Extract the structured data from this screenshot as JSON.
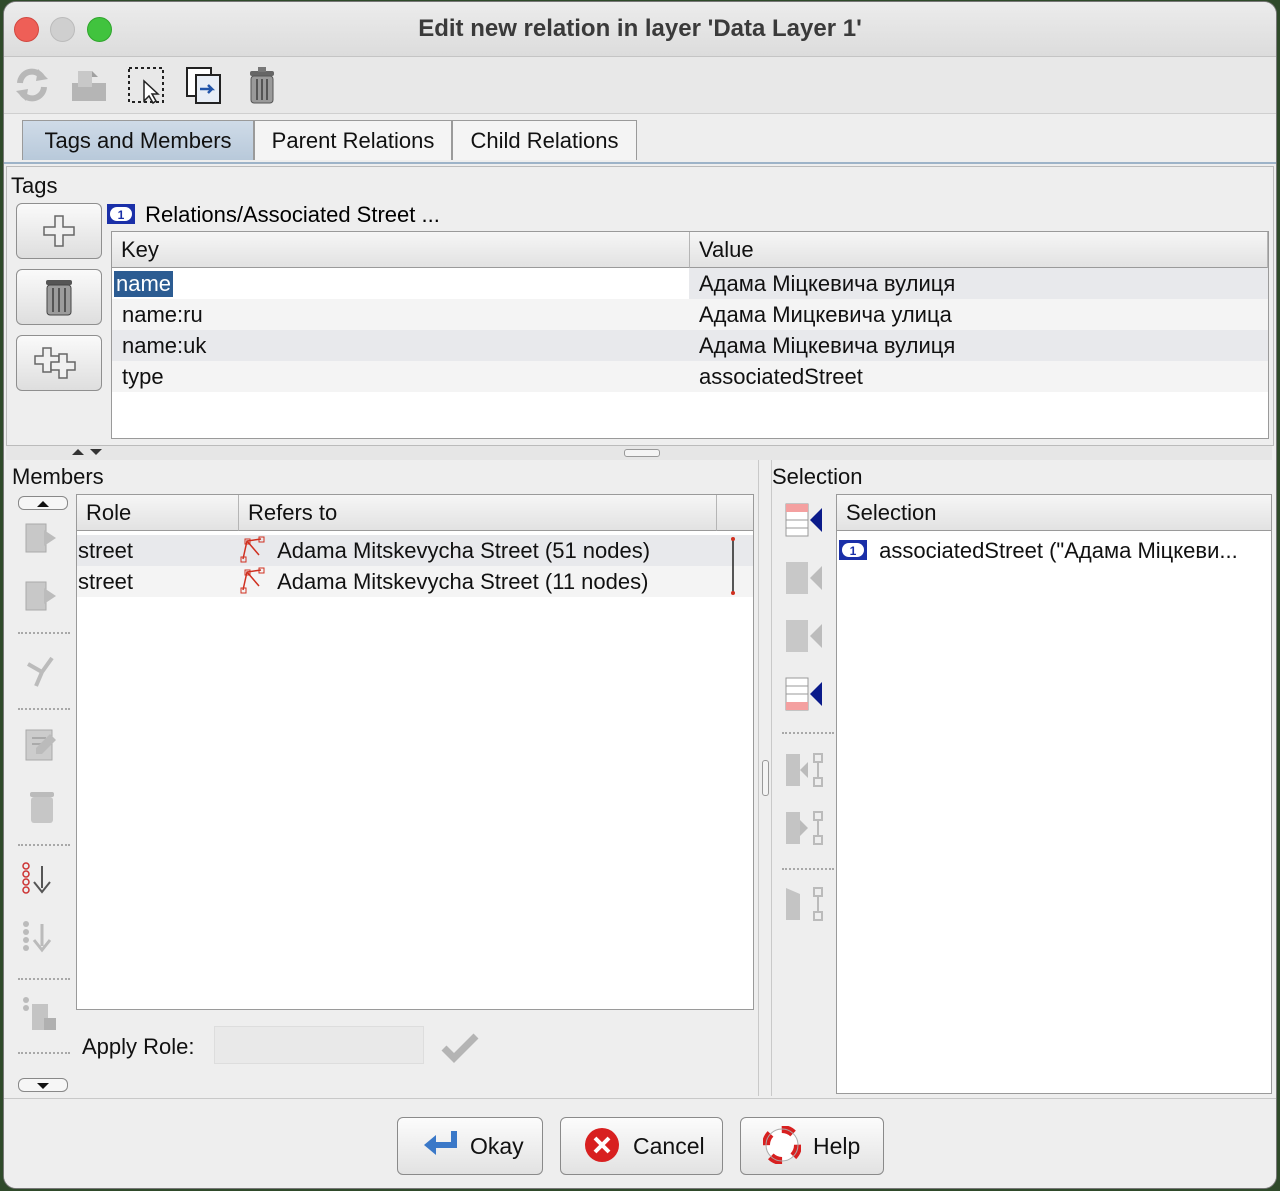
{
  "window": {
    "title": "Edit new relation in layer 'Data Layer 1'"
  },
  "toolbar": {
    "icons": [
      "refresh-icon",
      "upload-icon",
      "select-icon",
      "duplicate-icon",
      "trash-icon"
    ]
  },
  "tabs": [
    {
      "label": "Tags and Members",
      "active": true
    },
    {
      "label": "Parent Relations",
      "active": false
    },
    {
      "label": "Child Relations",
      "active": false
    }
  ],
  "tags": {
    "section_label": "Tags",
    "preset_label": "Relations/Associated Street ...",
    "columns": {
      "key": "Key",
      "value": "Value"
    },
    "rows": [
      {
        "key": "name",
        "value": "Адама Міцкевича вулиця"
      },
      {
        "key": "name:ru",
        "value": "Адама Мицкевича улица"
      },
      {
        "key": "name:uk",
        "value": "Адама Міцкевича вулиця"
      },
      {
        "key": "type",
        "value": "associatedStreet"
      }
    ]
  },
  "members": {
    "section_label": "Members",
    "columns": {
      "role": "Role",
      "refers_to": "Refers to"
    },
    "rows": [
      {
        "role": "street",
        "refers_to": "Adama Mitskevycha Street (51 nodes)"
      },
      {
        "role": "street",
        "refers_to": "Adama Mitskevycha Street (11 nodes)"
      }
    ],
    "apply_role_label": "Apply Role:",
    "apply_role_value": ""
  },
  "selection": {
    "section_label": "Selection",
    "column": "Selection",
    "items": [
      "associatedStreet (\"Адама Міцкеви..."
    ]
  },
  "buttons": {
    "ok": "Okay",
    "cancel": "Cancel",
    "help": "Help"
  },
  "colors": {
    "tab_active": "#c3d2e2",
    "selection_highlight": "#2c5c92",
    "relation_badge": "#1a2fa8",
    "cancel_red": "#d82020"
  }
}
